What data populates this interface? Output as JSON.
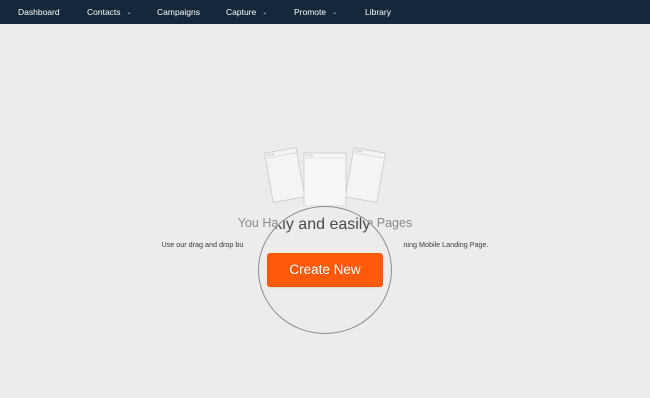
{
  "nav": {
    "items": [
      {
        "label": "Dashboard",
        "has_dropdown": false
      },
      {
        "label": "Contacts",
        "has_dropdown": true
      },
      {
        "label": "Campaigns",
        "has_dropdown": false
      },
      {
        "label": "Capture",
        "has_dropdown": true
      },
      {
        "label": "Promote",
        "has_dropdown": true
      },
      {
        "label": "Library",
        "has_dropdown": false
      }
    ],
    "dropdown_glyph": "⌄"
  },
  "empty_state": {
    "title": "You Ha",
    "title_tail": "e Pages",
    "description_left": "Use our drag and drop bu",
    "description_right": "ning Mobile Landing Page."
  },
  "magnifier": {
    "title": "ckly and easily b",
    "create_label": "Create New"
  },
  "colors": {
    "nav_bg": "#15273b",
    "page_bg": "#ececec",
    "accent": "#ff5a0a"
  },
  "icons": {
    "illustration": "landing-page-templates-illustration",
    "dropdown": "chevron-down-icon"
  }
}
